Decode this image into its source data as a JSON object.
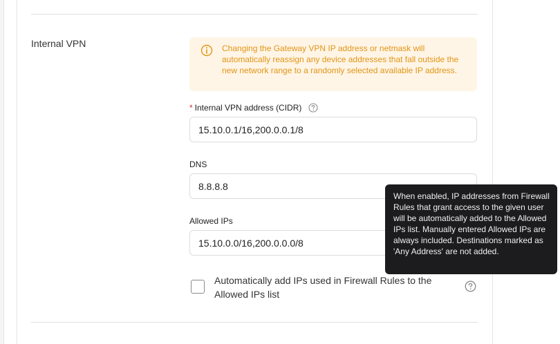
{
  "section": {
    "label": "Internal VPN"
  },
  "warning": {
    "icon": "info-icon",
    "color": "#e19415",
    "text": "Changing the Gateway VPN IP address or netmask will automatically reassign any device addresses that fall outside the new network range to a randomly selected available IP address."
  },
  "fields": {
    "internal_vpn": {
      "required_mark": "*",
      "label": "Internal VPN address (CIDR)",
      "value": "15.10.0.1/16,200.0.0.1/8"
    },
    "dns": {
      "label": "DNS",
      "value": "8.8.8.8"
    },
    "allowed_ips": {
      "label": "Allowed IPs",
      "value": "15.10.0.0/16,200.0.0.0/8"
    }
  },
  "checkbox": {
    "label": "Automatically add IPs used in Firewall Rules to the Allowed IPs list",
    "checked": false
  },
  "tooltip": {
    "text": "When enabled, IP addresses from Firewall Rules that grant access to the given user will be automatically added to the Allowed IPs list. Manually entered Allowed IPs are always included. Destinations marked as 'Any Address' are not added."
  }
}
